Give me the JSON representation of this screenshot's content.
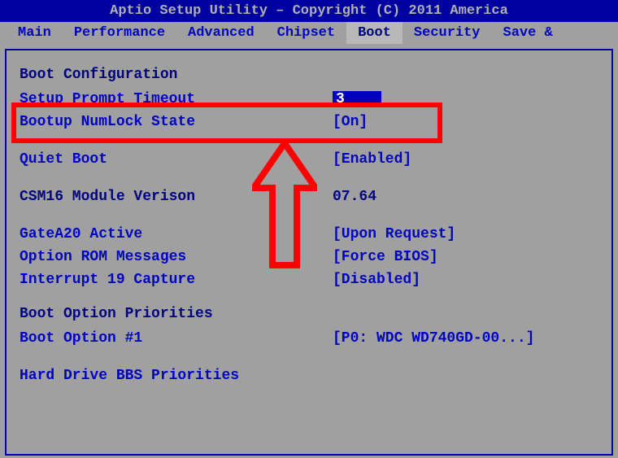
{
  "header": {
    "title": "Aptio Setup Utility – Copyright (C) 2011 America"
  },
  "tabs": [
    {
      "label": "Main",
      "active": false
    },
    {
      "label": "Performance",
      "active": false
    },
    {
      "label": "Advanced",
      "active": false
    },
    {
      "label": "Chipset",
      "active": false
    },
    {
      "label": "Boot",
      "active": true
    },
    {
      "label": "Security",
      "active": false
    },
    {
      "label": "Save & ",
      "active": false
    }
  ],
  "boot_config": {
    "section_title": "Boot Configuration",
    "setup_prompt_label": "Setup Prompt Timeout",
    "setup_prompt_value": "3",
    "numlock_label": "Bootup NumLock State",
    "numlock_value": "[On]",
    "quiet_boot_label": "Quiet Boot",
    "quiet_boot_value": "[Enabled]",
    "csm_label": "CSM16 Module Verison",
    "csm_value": "07.64",
    "gatea20_label": "GateA20 Active",
    "gatea20_value": "[Upon Request]",
    "option_rom_label": "Option ROM Messages",
    "option_rom_value": "[Force BIOS]",
    "interrupt19_label": "Interrupt 19 Capture",
    "interrupt19_value": "[Disabled]"
  },
  "boot_priorities": {
    "section_title": "Boot Option Priorities",
    "opt1_label": "Boot Option #1",
    "opt1_value": "[P0: WDC WD740GD-00...]",
    "hdd_bbs_label": "Hard Drive BBS Priorities"
  }
}
